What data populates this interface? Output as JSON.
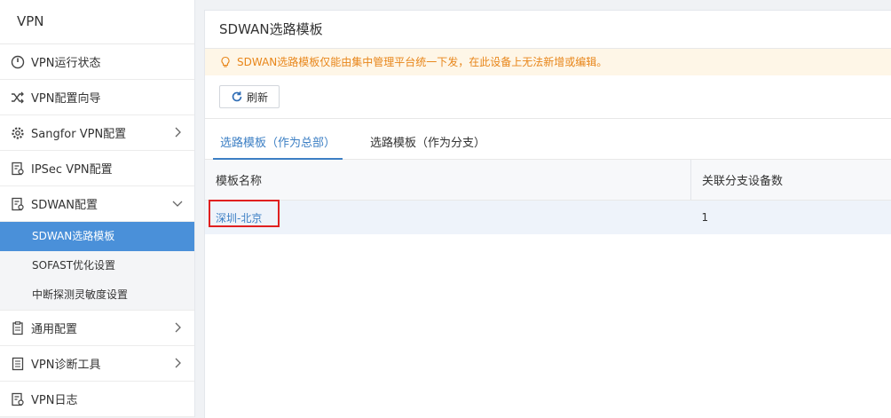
{
  "sidebar": {
    "title": "VPN",
    "items": [
      {
        "label": "VPN运行状态",
        "icon": "dashboard-icon"
      },
      {
        "label": "VPN配置向导",
        "icon": "shuffle-icon"
      },
      {
        "label": "Sangfor VPN配置",
        "icon": "gear-icon"
      },
      {
        "label": "IPSec VPN配置",
        "icon": "document-icon"
      },
      {
        "label": "SDWAN配置",
        "icon": "document-gear-icon"
      },
      {
        "label": "通用配置",
        "icon": "clipboard-icon"
      },
      {
        "label": "VPN诊断工具",
        "icon": "list-icon"
      },
      {
        "label": "VPN日志",
        "icon": "log-icon"
      }
    ],
    "sub_items": [
      {
        "label": "SDWAN选路模板",
        "active": true
      },
      {
        "label": "SOFAST优化设置",
        "active": false
      },
      {
        "label": "中断探测灵敏度设置",
        "active": false
      }
    ]
  },
  "main": {
    "title": "SDWAN选路模板",
    "notice": "SDWAN选路模板仅能由集中管理平台统一下发，在此设备上无法新增或编辑。",
    "refresh_label": "刷新",
    "tabs": [
      {
        "label": "选路模板（作为总部）",
        "active": true
      },
      {
        "label": "选路模板（作为分支）",
        "active": false
      }
    ],
    "table": {
      "headers": [
        "模板名称",
        "关联分支设备数"
      ],
      "rows": [
        {
          "name": "深圳-北京",
          "count": "1"
        }
      ]
    }
  },
  "colors": {
    "accent": "#3c7fc4",
    "active_nav": "#4a90d9",
    "notice_text": "#e8861a",
    "notice_bg": "#fef6e7",
    "highlight": "#e02020"
  }
}
